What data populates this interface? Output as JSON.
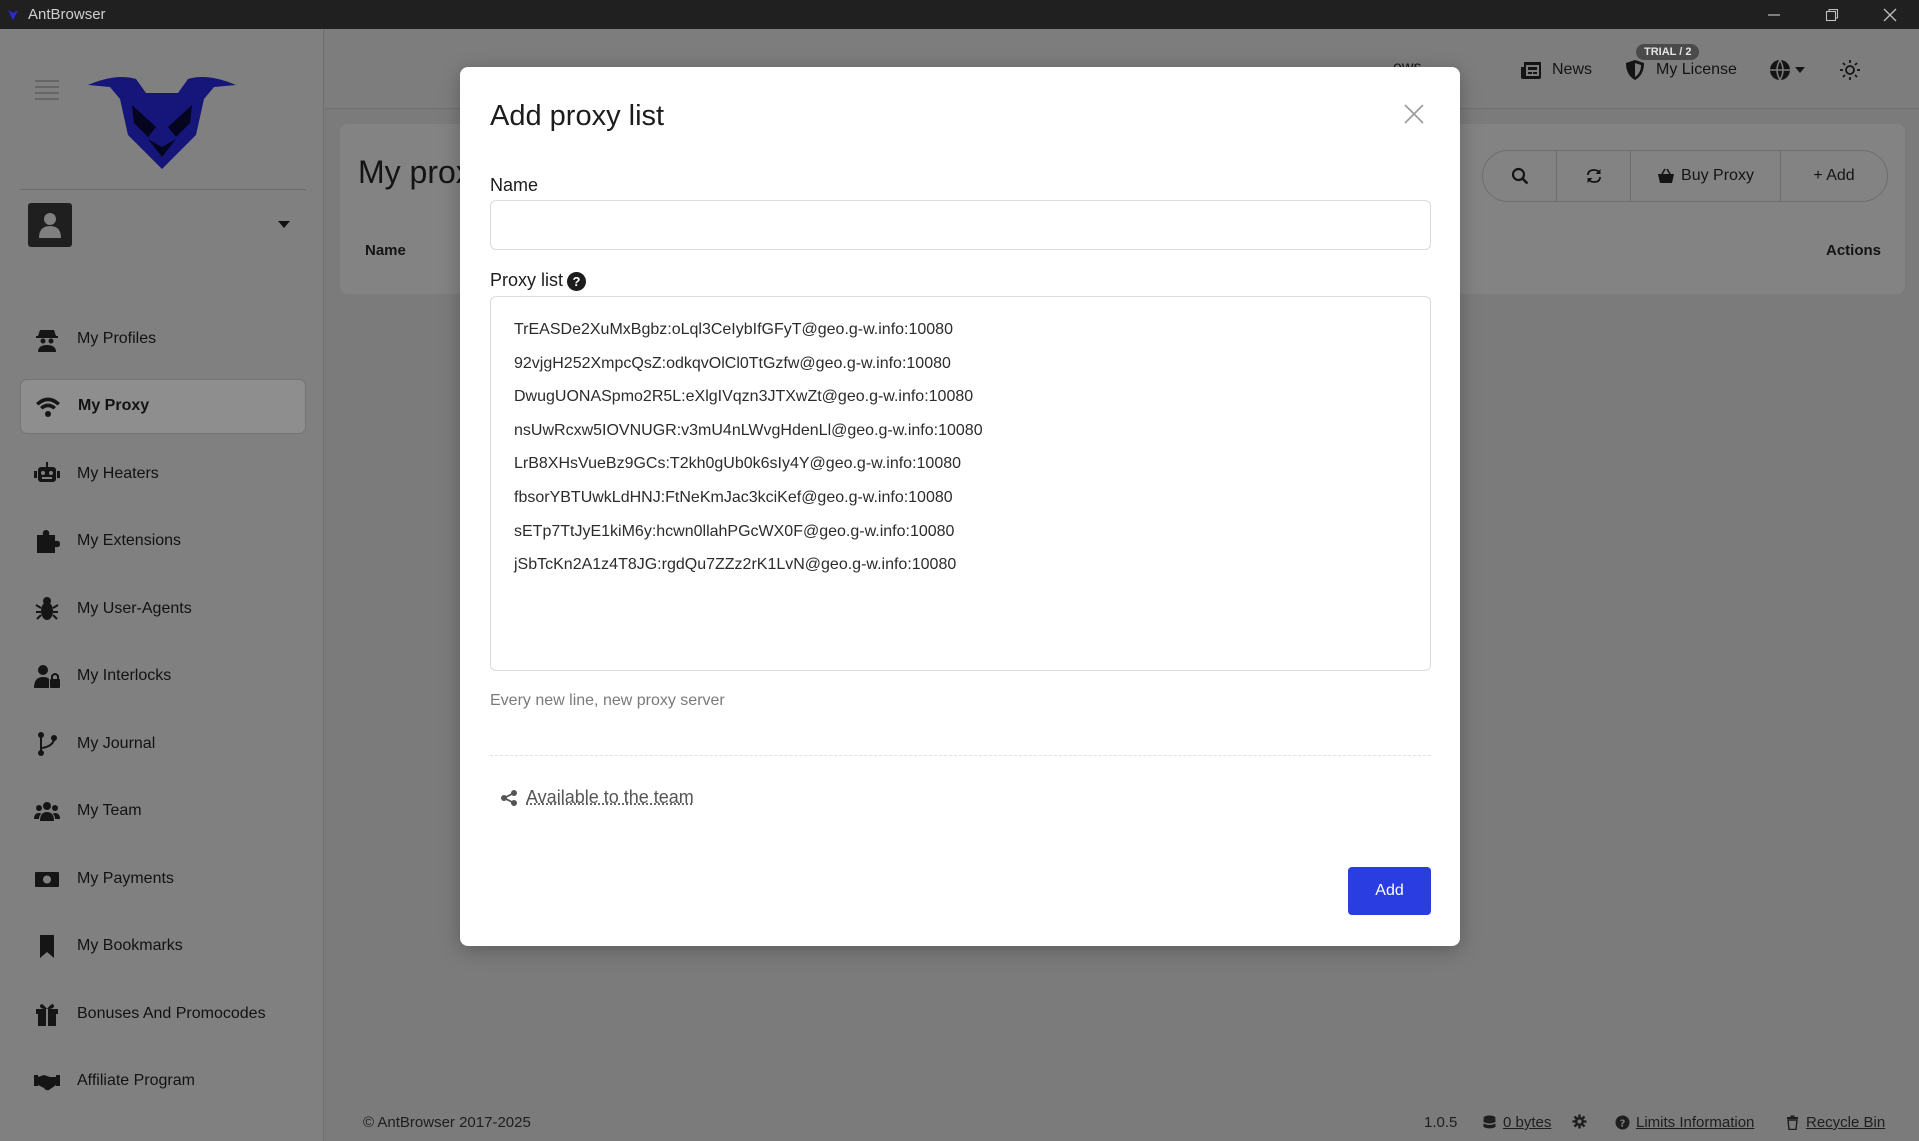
{
  "window": {
    "title": "AntBrowser"
  },
  "sidebar": {
    "items": [
      {
        "label": "My Profiles",
        "icon": "spy-icon"
      },
      {
        "label": "My Proxy",
        "icon": "wifi-icon",
        "active": true
      },
      {
        "label": "My Heaters",
        "icon": "robot-icon"
      },
      {
        "label": "My Extensions",
        "icon": "puzzle-icon"
      },
      {
        "label": "My User-Agents",
        "icon": "bug-icon"
      },
      {
        "label": "My Interlocks",
        "icon": "user-lock-icon"
      },
      {
        "label": "My Journal",
        "icon": "branch-icon"
      },
      {
        "label": "My Team",
        "icon": "users-icon"
      },
      {
        "label": "My Payments",
        "icon": "money-icon"
      },
      {
        "label": "My Bookmarks",
        "icon": "bookmark-icon"
      },
      {
        "label": "Bonuses And Promocodes",
        "icon": "gift-icon"
      },
      {
        "label": "Affiliate Program",
        "icon": "handshake-icon"
      }
    ]
  },
  "header": {
    "news_label": "News",
    "license_label": "My License",
    "reviews_fragment": "ews",
    "trial_badge": "TRIAL / 2"
  },
  "page": {
    "title_fragment": "My prox",
    "columns": {
      "name": "Name",
      "actions": "Actions"
    },
    "buy_proxy_label": "Buy Proxy",
    "add_label": "+ Add"
  },
  "footer": {
    "copyright": "© AntBrowser 2017-2025",
    "version": "1.0.5",
    "storage": "0 bytes",
    "limits_label": "Limits Information",
    "recycle_label": "Recycle Bin"
  },
  "modal": {
    "title": "Add proxy list",
    "name_label": "Name",
    "name_value": "",
    "proxy_label": "Proxy list",
    "proxy_lines": [
      "TrEASDe2XuMxBgbz:oLql3CeIybIfGFyT@geo.g-w.info:10080",
      "92vjgH252XmpcQsZ:odkqvOlCl0TtGzfw@geo.g-w.info:10080",
      "DwugUONASpmo2R5L:eXlgIVqzn3JTXwZt@geo.g-w.info:10080",
      "nsUwRcxw5IOVNUGR:v3mU4nLWvgHdenLl@geo.g-w.info:10080",
      "LrB8XHsVueBz9GCs:T2kh0gUb0k6sIy4Y@geo.g-w.info:10080",
      "fbsorYBTUwkLdHNJ:FtNeKmJac3kciKef@geo.g-w.info:10080",
      "sETp7TtJyE1kiM6y:hcwn0llahPGcWX0F@geo.g-w.info:10080",
      "jSbTcKn2A1z4T8JG:rgdQu7ZZz2rK1LvN@geo.g-w.info:10080"
    ],
    "hint": "Every new line, new proxy server",
    "share_label": "Available to the team",
    "add_button": "Add",
    "accent_color": "#2a3de0"
  }
}
